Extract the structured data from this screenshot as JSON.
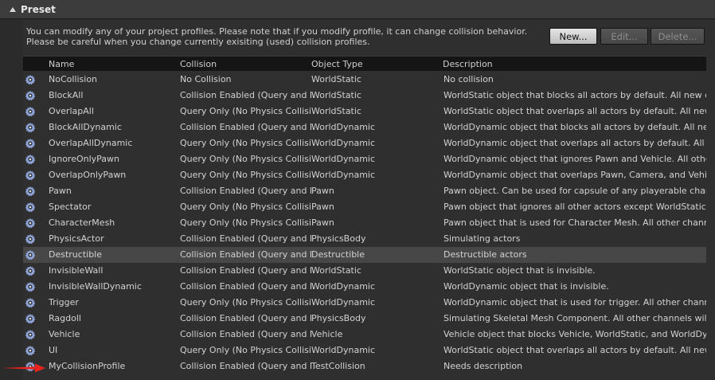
{
  "section": {
    "title": "Preset"
  },
  "info": {
    "text": "You can modify any of your project profiles. Please note that if you modify profile, it can change collision behavior. Please be careful when you change currently exisiting (used) collision profiles."
  },
  "buttons": {
    "new": "New...",
    "edit": "Edit...",
    "delete": "Delete..."
  },
  "columns": {
    "name": "Name",
    "collision": "Collision",
    "object_type": "Object Type",
    "description": "Description"
  },
  "rows": [
    {
      "name": "NoCollision",
      "collision": "No Collision",
      "object_type": "WorldStatic",
      "description": "No collision"
    },
    {
      "name": "BlockAll",
      "collision": "Collision Enabled (Query and Phy",
      "object_type": "WorldStatic",
      "description": "WorldStatic object that blocks all actors by default. All new custor"
    },
    {
      "name": "OverlapAll",
      "collision": "Query Only (No Physics Collision",
      "object_type": "WorldStatic",
      "description": "WorldStatic object that overlaps all actors by default. All new cust"
    },
    {
      "name": "BlockAllDynamic",
      "collision": "Collision Enabled (Query and Phy",
      "object_type": "WorldDynamic",
      "description": "WorldDynamic object that blocks all actors by default. All new custo"
    },
    {
      "name": "OverlapAllDynamic",
      "collision": "Query Only (No Physics Collision",
      "object_type": "WorldDynamic",
      "description": "WorldDynamic object that overlaps all actors by default. All new cu"
    },
    {
      "name": "IgnoreOnlyPawn",
      "collision": "Query Only (No Physics Collision",
      "object_type": "WorldDynamic",
      "description": "WorldDynamic object that ignores Pawn and Vehicle. All other chan"
    },
    {
      "name": "OverlapOnlyPawn",
      "collision": "Query Only (No Physics Collision",
      "object_type": "WorldDynamic",
      "description": "WorldDynamic object that overlaps Pawn, Camera, and Vehicle. All"
    },
    {
      "name": "Pawn",
      "collision": "Collision Enabled (Query and Phy",
      "object_type": "Pawn",
      "description": "Pawn object. Can be used for capsule of any playerable character o"
    },
    {
      "name": "Spectator",
      "collision": "Query Only (No Physics Collision",
      "object_type": "Pawn",
      "description": "Pawn object that ignores all other actors except WorldStatic."
    },
    {
      "name": "CharacterMesh",
      "collision": "Query Only (No Physics Collision",
      "object_type": "Pawn",
      "description": "Pawn object that is used for Character Mesh. All other channels w"
    },
    {
      "name": "PhysicsActor",
      "collision": "Collision Enabled (Query and Phy",
      "object_type": "PhysicsBody",
      "description": "Simulating actors"
    },
    {
      "name": "Destructible",
      "collision": "Collision Enabled (Query and Phy",
      "object_type": "Destructible",
      "description": "Destructible actors"
    },
    {
      "name": "InvisibleWall",
      "collision": "Collision Enabled (Query and Phy",
      "object_type": "WorldStatic",
      "description": "WorldStatic object that is invisible."
    },
    {
      "name": "InvisibleWallDynamic",
      "collision": "Collision Enabled (Query and Phy",
      "object_type": "WorldDynamic",
      "description": "WorldDynamic object that is invisible."
    },
    {
      "name": "Trigger",
      "collision": "Query Only (No Physics Collision",
      "object_type": "WorldDynamic",
      "description": "WorldDynamic object that is used for trigger. All other channels wi"
    },
    {
      "name": "Ragdoll",
      "collision": "Collision Enabled (Query and Phy",
      "object_type": "PhysicsBody",
      "description": "Simulating Skeletal Mesh Component. All other channels will be s"
    },
    {
      "name": "Vehicle",
      "collision": "Collision Enabled (Query and Phy",
      "object_type": "Vehicle",
      "description": "Vehicle object that blocks Vehicle, WorldStatic, and WorldDynamic"
    },
    {
      "name": "UI",
      "collision": "Query Only (No Physics Collision",
      "object_type": "WorldDynamic",
      "description": "WorldStatic object that overlaps all actors by default. All new cust"
    },
    {
      "name": "MyCollisionProfile",
      "collision": "Collision Enabled (Query and Phy",
      "object_type": "TestCollision",
      "description": "Needs description"
    }
  ],
  "selected_row": "Destructible",
  "colors": {
    "background": "#2b2b2b",
    "header": "#151515",
    "selected": "#474747",
    "icon": "#8fa4d6",
    "annotation_arrow": "#e8231e"
  }
}
